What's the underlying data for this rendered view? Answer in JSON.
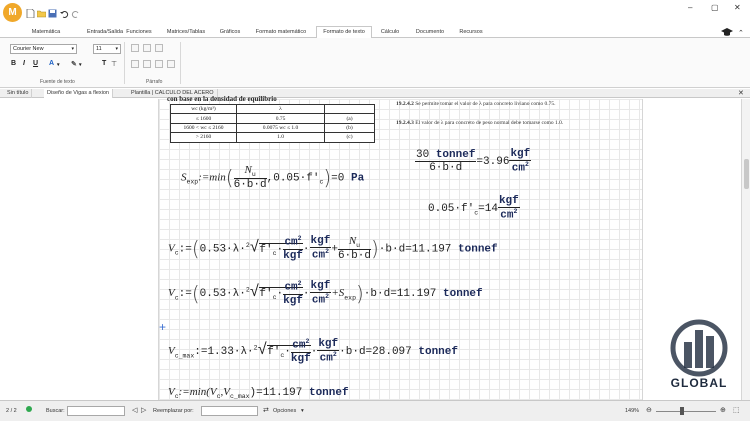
{
  "app": {
    "logo_letter": "M"
  },
  "ribbon_tabs": [
    "Matemática",
    "Entrada/Salida",
    "Funciones",
    "Matrices/Tablas",
    "Gráficos",
    "Formato matemático",
    "Formato de texto",
    "Cálculo",
    "Documento",
    "Recursos"
  ],
  "active_tab_index": 6,
  "ribbon": {
    "font_name": "Courier New",
    "font_size": "11",
    "bold": "B",
    "italic": "I",
    "underline": "U",
    "text_style_icon": "T",
    "group_font_label": "Fuente de texto",
    "group_paragraph_label": "Párrafo"
  },
  "doc_tabs": [
    "Sin título",
    "Diseño de Vigas a flexion",
    "Plantilla | CALCULO DEL ACERO"
  ],
  "active_doc_tab": 1,
  "image": {
    "heading": "con base en la densidad de equilibrio",
    "table": [
      [
        "wc (kg/m³)",
        "λ",
        ""
      ],
      [
        "≤ 1600",
        "0.75",
        "(a)"
      ],
      [
        "1600 < wc ≤ 2160",
        "0.0075 wc ≤ 1.0",
        "(b)"
      ],
      [
        "> 2160",
        "1.0",
        "(c)"
      ]
    ],
    "note1_bold": "19.2.4.2",
    "note1": "Se permite tomar el valor de λ para concreto liviano como 0.75.",
    "note2_bold": "19.2.4.3",
    "note2": "El valor de λ para concreto de peso normal debe tomarse como 1.0."
  },
  "math": {
    "sexp_lhs": "S",
    "sexp_sub": "exp",
    "sexp_def": ":=min",
    "sexp_num": "N",
    "sexp_num_sub": "u",
    "sexp_den": "6·b·d",
    "sexp_mid": ",0.05·f'",
    "sexp_c": "c",
    "sexp_result": "=0",
    "sexp_unit": "Pa",
    "r1_num": "30",
    "r1_num_unit": "tonnef",
    "r1_den": "6·b·d",
    "r1_eq": "=3.96",
    "r1_unit_num": "kgf",
    "r1_unit_den": "cm",
    "r1_unit_exp": "2",
    "r2_expr": "0.05·f'",
    "r2_c": "c",
    "r2_eq": "=14",
    "r2_unit_num": "kgf",
    "r2_unit_den": "cm",
    "r2_unit_exp": "2",
    "vc1_lhs": "V",
    "vc1_sub": "c",
    "vc1_prefix": ":=",
    "coef": "0.53·λ·",
    "root_index": "2",
    "fc": "f'",
    "fc_sub": "c",
    "cm2": "cm",
    "cm2_exp": "2",
    "kgf": "kgf",
    "nu": "N",
    "nu_sub": "u",
    "den6bd": "6·b·d",
    "bd": "·b·d",
    "vc1_result": "=11.197",
    "tonnef": "tonnef",
    "sexp_term": "+S",
    "vc2_result": "=11.197",
    "vcmax_lhs": "V",
    "vcmax_sub": "c_max",
    "vcmax_coef": ":=1.33·λ·",
    "vcmax_result": "=28.097",
    "vc4_lhs": "V",
    "vc4_sub": "c",
    "vc4_def": ":=min",
    "vc4_args": "(V",
    "vc4_arg2": ",V",
    "vc4_arg2_sub": "c_max",
    "vc4_close": ")",
    "vc4_result": "=11.197"
  },
  "status": {
    "page": "2 / 2",
    "search_label": "Buscar:",
    "replace_label": "Reemplazar por:",
    "options_label": "Opciones",
    "zoom": "149%"
  },
  "watermark": {
    "title": "GLOBAL"
  },
  "colors": {
    "accent_tab_border": "#c8c8c8",
    "unit_color": "#1c2a5a",
    "logo": "#f0a82a"
  }
}
